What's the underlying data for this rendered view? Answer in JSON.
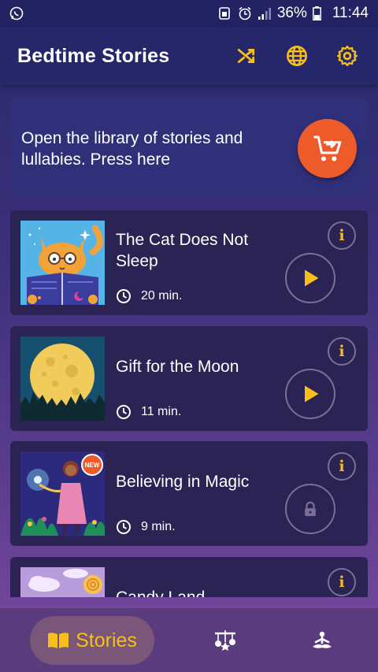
{
  "status": {
    "battery": "36%",
    "time": "11:44"
  },
  "app": {
    "title": "Bedtime Stories"
  },
  "icons": {
    "shuffle": "shuffle-icon",
    "language": "globe-icon",
    "settings": "gear-icon",
    "cart": "add-to-cart-icon",
    "clock": "clock-icon",
    "info": "info-icon",
    "play": "play-icon",
    "lock": "lock-icon",
    "book": "book-icon",
    "mobile": "crib-mobile-icon",
    "meditation": "meditation-icon"
  },
  "banner": {
    "text": "Open the library of stories and lullabies. Press here"
  },
  "stories": [
    {
      "title": "The Cat Does Not Sleep",
      "duration": "20 min.",
      "info": "i",
      "state": "play"
    },
    {
      "title": "Gift for the Moon",
      "duration": "11 min.",
      "info": "i",
      "state": "play"
    },
    {
      "title": "Believing in Magic",
      "duration": "9 min.",
      "info": "i",
      "state": "locked",
      "badge": "NEW"
    },
    {
      "title": "Candy Land",
      "info": "i"
    }
  ],
  "nav": {
    "stories_label": "Stories"
  },
  "colors": {
    "accent": "#f6bf1a",
    "cart": "#ee5b2a",
    "card": "#2b2353"
  }
}
